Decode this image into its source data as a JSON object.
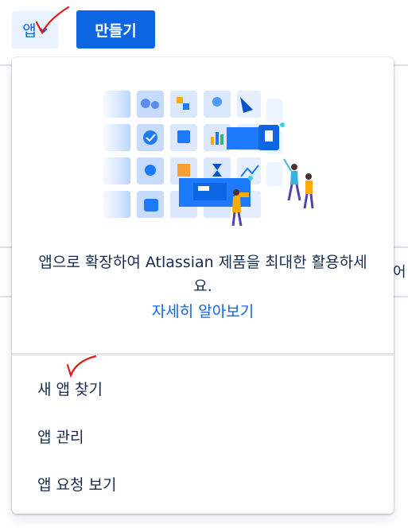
{
  "topbar": {
    "apps_label": "앱",
    "create_label": "만들기"
  },
  "background": {
    "partial_text": "어"
  },
  "dropdown": {
    "promo_text": "앱으로 확장하여 Atlassian 제품을 최대한 활용하세요.",
    "learn_more_label": "자세히 알아보기",
    "menu_items": [
      {
        "label": "새 앱 찾기"
      },
      {
        "label": "앱 관리"
      },
      {
        "label": "앱 요청 보기"
      }
    ]
  },
  "colors": {
    "brand_blue": "#0c66e4",
    "apps_button_bg": "#e9f2ff",
    "annotation_red": "#e01919"
  }
}
